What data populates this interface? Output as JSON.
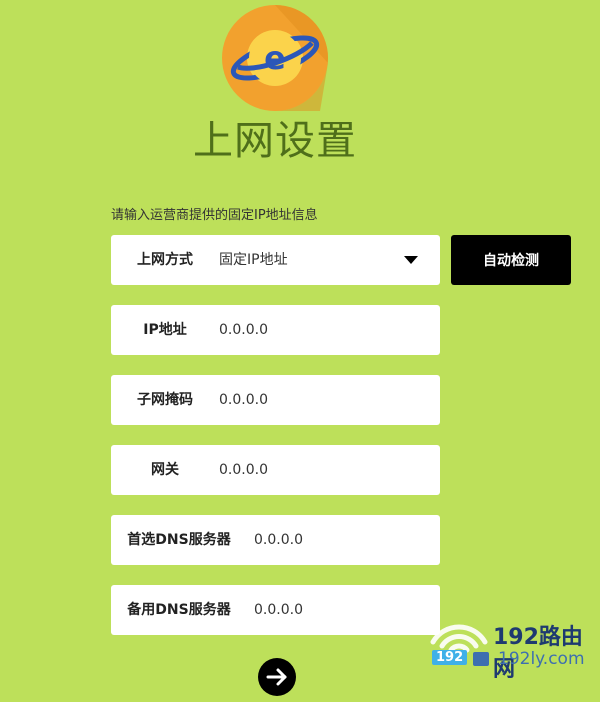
{
  "title": "上网设置",
  "hint": "请输入运营商提供的固定IP地址信息",
  "conn_type": {
    "label": "上网方式",
    "value": "固定IP地址"
  },
  "auto_detect_label": "自动检测",
  "fields": [
    {
      "label": "IP地址",
      "value": "0.0.0.0"
    },
    {
      "label": "子网掩码",
      "value": "0.0.0.0"
    },
    {
      "label": "网关",
      "value": "0.0.0.0"
    },
    {
      "label": "首选DNS服务器",
      "value": "0.0.0.0"
    },
    {
      "label": "备用DNS服务器",
      "value": "0.0.0.0"
    }
  ],
  "next_icon": "arrow-right-icon",
  "logo_icon": "planet-e-icon",
  "watermark": {
    "brand": "192路由网",
    "num": "192",
    "url": "192ly.com"
  },
  "colors": {
    "background": "#bde05a",
    "title": "#4f6f1a",
    "logo_orange": "#f2a12e",
    "button": "#000000"
  }
}
